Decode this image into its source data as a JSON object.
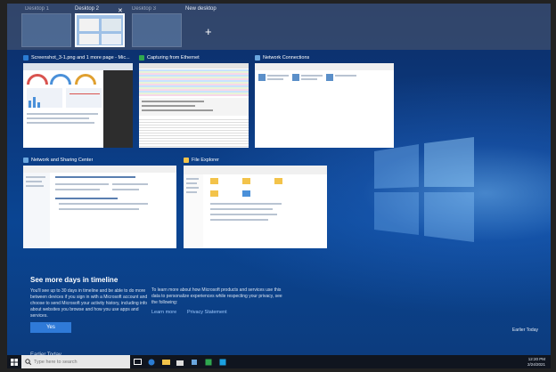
{
  "virtual_desktops": {
    "items": [
      {
        "label": "Desktop 1"
      },
      {
        "label": "Desktop 2"
      },
      {
        "label": "Desktop 3"
      }
    ],
    "new_desktop_label": "New desktop",
    "close_glyph": "✕",
    "add_glyph": "+"
  },
  "task_view": {
    "windows": [
      {
        "title": "Screenshot_3-1.png and 1 more page - Mic...",
        "icon": "edge-icon",
        "icon_color": "#2b7cd3"
      },
      {
        "title": "Capturing from Ethernet",
        "icon": "wireshark-icon",
        "icon_color": "#2fa84f"
      },
      {
        "title": "Network Connections",
        "icon": "network-connections-icon",
        "icon_color": "#6aa6de"
      },
      {
        "title": "Network and Sharing Center",
        "icon": "network-sharing-icon",
        "icon_color": "#6aa6de"
      },
      {
        "title": "File Explorer",
        "icon": "folder-icon",
        "icon_color": "#f3c34a"
      }
    ]
  },
  "timeline": {
    "title": "See more days in timeline",
    "description": "You'll see up to 30 days in timeline and be able to do more between devices if you sign in with a Microsoft account and choose to send Microsoft your activity history, including info about websites you browse and how you use apps and services.",
    "yes_label": "Yes",
    "learn_text": "To learn more about how Microsoft products and services use this data to personalize experiences while respecting your privacy, see the following:",
    "learn_more_label": "Learn more",
    "privacy_label": "Privacy Statement",
    "earlier_today_right": "Earlier Today",
    "earlier_today_bottom": "Earlier Today"
  },
  "taskbar": {
    "search_placeholder": "Type here to search",
    "time": "12:20 PM",
    "date": "2/24/2021"
  },
  "colors": {
    "accent": "#2f7ad8",
    "link": "#9cc8ff"
  }
}
